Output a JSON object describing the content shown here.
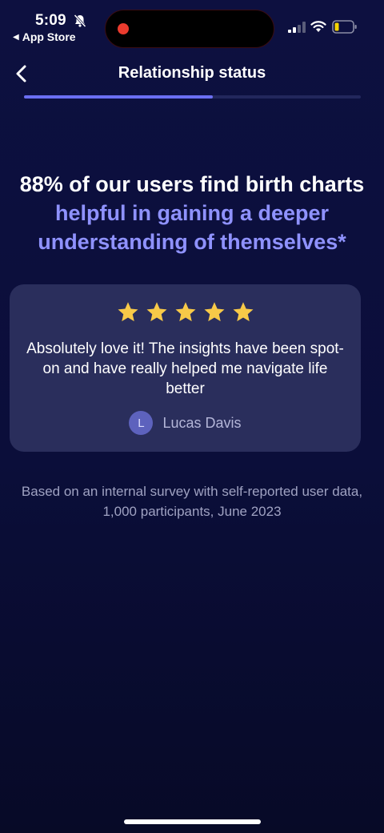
{
  "status_bar": {
    "time": "5:09",
    "back_app_label": "App Store"
  },
  "nav": {
    "title": "Relationship status",
    "progress_fraction": 0.56
  },
  "headline": {
    "part_white": "88% of our users find birth charts",
    "part_accent": "helpful in gaining a deeper understanding of themselves*"
  },
  "review": {
    "rating": 5,
    "rating_max": 5,
    "text": "Absolutely love it! The insights have been spot-on and have really helped me navigate life better",
    "avatar_initial": "L",
    "reviewer_name": "Lucas Davis"
  },
  "footnote": "Based on an internal survey with self-reported user data, 1,000 participants, June 2023",
  "colors": {
    "background": "#0d1040",
    "accent": "#8f92ff",
    "progress": "#6b6ff2",
    "card": "#2a2e5c",
    "star": "#f7c948"
  }
}
